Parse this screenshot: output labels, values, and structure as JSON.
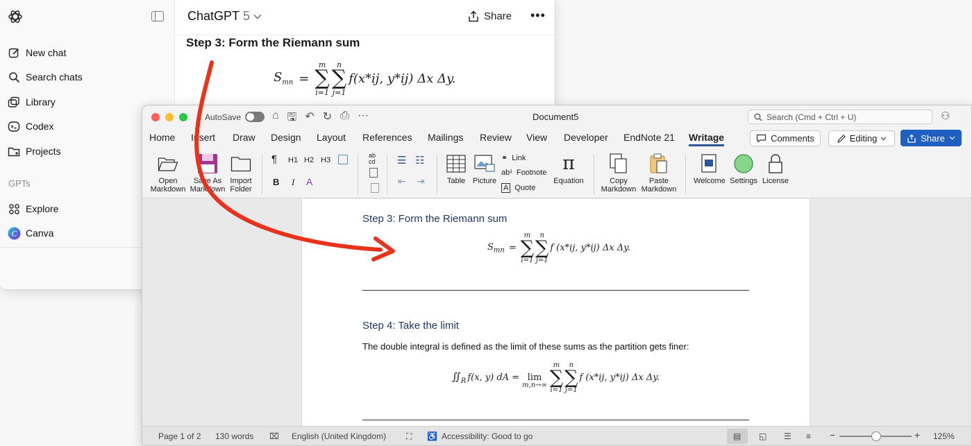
{
  "chatgpt": {
    "sidebar": {
      "items": [
        {
          "label": "New chat",
          "icon": "new-chat-icon"
        },
        {
          "label": "Search chats",
          "icon": "search-icon"
        },
        {
          "label": "Library",
          "icon": "library-icon"
        },
        {
          "label": "Codex",
          "icon": "codex-icon"
        },
        {
          "label": "Projects",
          "icon": "projects-icon"
        }
      ],
      "gpts_heading": "GPTs",
      "gpts": [
        {
          "label": "Explore",
          "icon": "explore-icon"
        },
        {
          "label": "Canva",
          "icon": "canva-icon"
        }
      ]
    },
    "header": {
      "model": "ChatGPT",
      "version": "5",
      "share_label": "Share",
      "more_label": "•••"
    },
    "message": {
      "heading": "Step 3: Form the Riemann sum",
      "equation": {
        "lhs": "S",
        "lhs_sub": "mn",
        "equals": "=",
        "sum1_upper": "m",
        "sum1_lower": "i=1",
        "sum2_upper": "n",
        "sum2_lower": "j=1",
        "body": "f(x*ij, y*ij) Δx Δy."
      }
    }
  },
  "word": {
    "title": "Document5",
    "autosave_label": "AutoSave",
    "search_placeholder": "Search (Cmd + Ctrl + U)",
    "tabs": [
      "Home",
      "Insert",
      "Draw",
      "Design",
      "Layout",
      "References",
      "Mailings",
      "Review",
      "View",
      "Developer",
      "EndNote 21",
      "Writage"
    ],
    "active_tab": "Writage",
    "comments_label": "Comments",
    "editing_label": "Editing",
    "share_label": "Share",
    "ribbon": {
      "open_markdown": "Open Markdown",
      "save_as_markdown": "Save As Markdown",
      "import_folder": "Import Folder",
      "h1": "H1",
      "h2": "H2",
      "h3": "H3",
      "bold": "B",
      "italic": "I",
      "table": "Table",
      "picture": "Picture",
      "link": "Link",
      "footnote": "Footnote",
      "quote": "Quote",
      "equation": "Equation",
      "copy_markdown": "Copy Markdown",
      "paste_markdown": "Paste Markdown",
      "welcome": "Welcome",
      "settings": "Settings",
      "license": "License"
    },
    "document": {
      "step3_heading": "Step 3: Form the Riemann sum",
      "step4_heading": "Step 4: Take the limit",
      "step4_text": "The double integral is defined as the limit of these sums as the partition gets finer:",
      "eq1": {
        "lhs": "S",
        "lhs_sub": "mn",
        "equals": "=",
        "sum1_upper": "m",
        "sum1_lower": "i=1",
        "sum2_upper": "n",
        "sum2_lower": "j=1",
        "body": "f (x*ij, y*ij) Δx Δy."
      },
      "eq2": {
        "lhs": "∬",
        "lhs_sub": "R",
        "integrand": "f(x, y) dA =",
        "lim": "lim",
        "lim_sub": "m,n→∞",
        "sum1_upper": "m",
        "sum1_lower": "i=1",
        "sum2_upper": "n",
        "sum2_lower": "j=1",
        "body": "f (x*ij, y*ij) Δx Δy."
      }
    },
    "status": {
      "page": "Page 1 of 2",
      "words": "130 words",
      "language": "English (United Kingdom)",
      "accessibility": "Accessibility: Good to go",
      "zoom": "125%",
      "zoom_minus": "−",
      "zoom_plus": "+"
    }
  },
  "colors": {
    "arrow": "#e8321c",
    "share_blue": "#1f5fc0",
    "heading_blue": "#1f3864",
    "save_md_purple": "#9b2e8f"
  }
}
